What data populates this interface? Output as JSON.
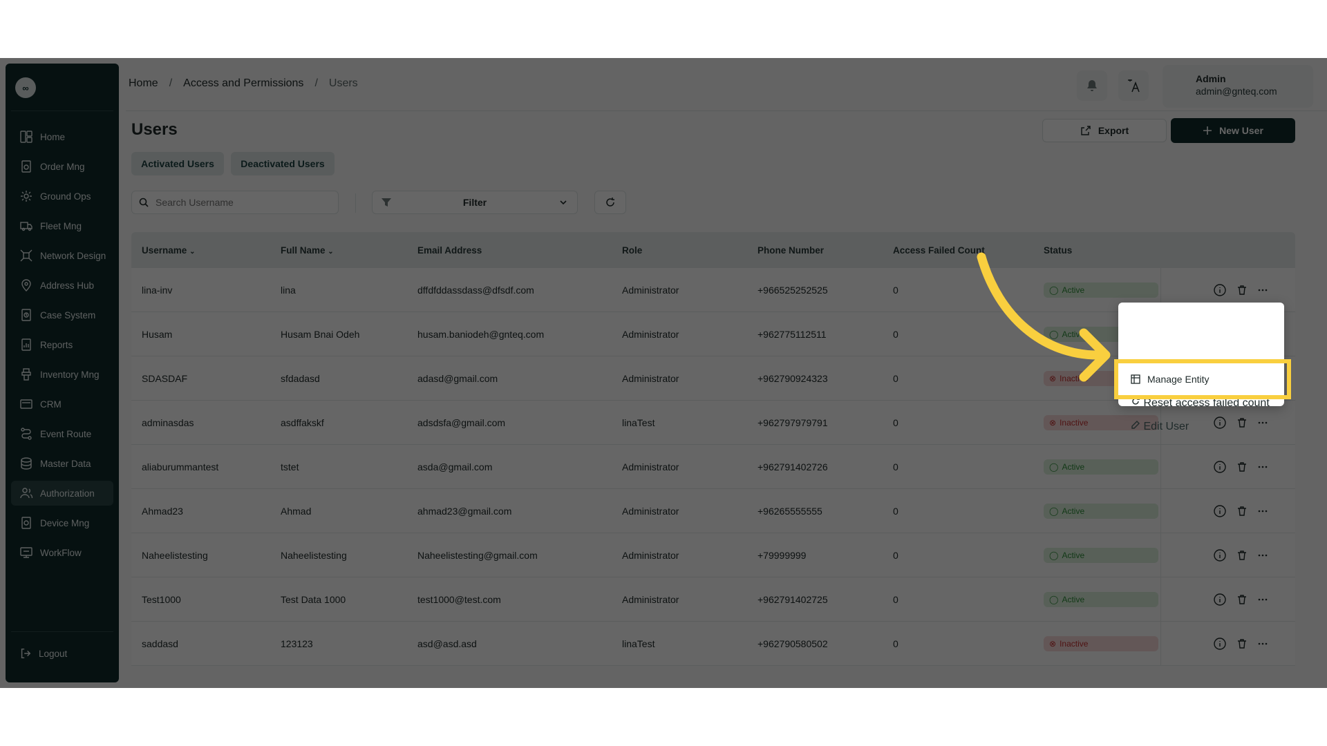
{
  "sidebar": {
    "logo": "∞",
    "items": [
      {
        "label": "Home",
        "icon": "home-icon"
      },
      {
        "label": "Order Mng",
        "icon": "order-icon"
      },
      {
        "label": "Ground Ops",
        "icon": "ground-ops-icon"
      },
      {
        "label": "Fleet Mng",
        "icon": "truck-icon"
      },
      {
        "label": "Network Design",
        "icon": "network-icon"
      },
      {
        "label": "Address Hub",
        "icon": "location-icon"
      },
      {
        "label": "Case System",
        "icon": "case-icon"
      },
      {
        "label": "Reports",
        "icon": "reports-icon"
      },
      {
        "label": "Inventory Mng",
        "icon": "inventory-icon"
      },
      {
        "label": "CRM",
        "icon": "crm-icon"
      },
      {
        "label": "Event Route",
        "icon": "route-icon"
      },
      {
        "label": "Master Data",
        "icon": "database-icon"
      },
      {
        "label": "Authorization",
        "icon": "users-icon",
        "active": true
      },
      {
        "label": "Device Mng",
        "icon": "device-icon"
      },
      {
        "label": "WorkFlow",
        "icon": "workflow-icon"
      }
    ],
    "logout": "Logout"
  },
  "breadcrumb": {
    "home": "Home",
    "section": "Access and Permissions",
    "current": "Users",
    "sep": "/"
  },
  "user": {
    "name": "Admin",
    "email": "admin@gnteq.com"
  },
  "page": {
    "title": "Users",
    "export_label": "Export",
    "new_user_label": "New User",
    "tabs": [
      "Activated Users",
      "Deactivated Users"
    ],
    "search_placeholder": "Search Username",
    "filter_label": "Filter"
  },
  "table": {
    "headers": [
      "Username",
      "Full Name",
      "Email Address",
      "Role",
      "Phone Number",
      "Access Failed Count",
      "Status"
    ],
    "rows": [
      [
        "lina-inv",
        "lina",
        "dffdfddassdass@dfsdf.com",
        "Administrator",
        "+966525252525",
        "0",
        "Active"
      ],
      [
        "Husam",
        "Husam Bnai Odeh",
        "husam.baniodeh@gnteq.com",
        "Administrator",
        "+962775112511",
        "0",
        "Active"
      ],
      [
        "SDASDAF",
        "sfdadasd",
        "adasd@gmail.com",
        "Administrator",
        "+962790924323",
        "0",
        "Inactive"
      ],
      [
        "adminasdas",
        "asdffakskf",
        "adsdsfa@gmail.com",
        "linaTest",
        "+962797979791",
        "0",
        "Inactive"
      ],
      [
        "aliaburummantest",
        "tstet",
        "asda@gmail.com",
        "Administrator",
        "+962791402726",
        "0",
        "Active"
      ],
      [
        "Ahmad23",
        "Ahmad",
        "ahmad23@gmail.com",
        "Administrator",
        "+96265555555",
        "0",
        "Active"
      ],
      [
        "Naheelistesting",
        "Naheelistesting",
        "Naheelistesting@gmail.com",
        "Administrator",
        "+79999999",
        "0",
        "Active"
      ],
      [
        "Test1000",
        "Test Data 1000",
        "test1000@test.com",
        "Administrator",
        "+962791402725",
        "0",
        "Active"
      ],
      [
        "saddasd",
        "123123",
        "asd@asd.asd",
        "linaTest",
        "+962790580502",
        "0",
        "Inactive"
      ]
    ]
  },
  "context_menu": {
    "items": [
      "Manage Entity",
      "Reset access failed count",
      "Edit User"
    ]
  },
  "colors": {
    "sidebar": "#0f2b2b",
    "primary": "#0f2b2b",
    "highlight": "#f9cf3f",
    "active": "#2f8f3a",
    "inactive": "#c53030"
  }
}
